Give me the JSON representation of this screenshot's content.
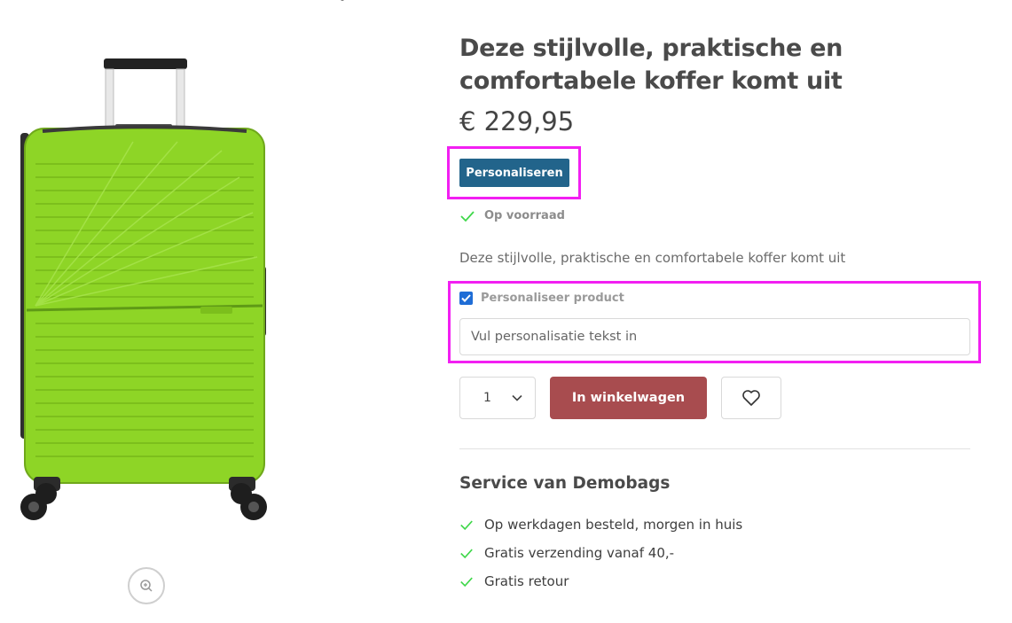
{
  "product": {
    "title": "Deze stijlvolle, praktische en comfortabele koffer komt uit",
    "price": "€ 229,95",
    "personalize_button": "Personaliseren",
    "stock_status": "Op voorraad",
    "description": "Deze stijlvolle, praktische en comfortabele koffer komt uit",
    "image_color": "#8ed526"
  },
  "personalization": {
    "checkbox_label": "Personaliseer product",
    "checked": true,
    "input_placeholder": "Vul personalisatie tekst in"
  },
  "purchase": {
    "quantity": "1",
    "add_to_cart": "In winkelwagen",
    "wishlist_icon": "heart-icon"
  },
  "service": {
    "title": "Service van Demobags",
    "items": [
      {
        "label": "Op werkdagen besteld, morgen in huis"
      },
      {
        "label": "Gratis verzending vanaf 40,-"
      },
      {
        "label": "Gratis retour"
      }
    ]
  },
  "colors": {
    "primary_button": "#22648b",
    "cart_button": "#a84c4f",
    "check": "#3fd74a",
    "highlight": "#f21ff2"
  }
}
